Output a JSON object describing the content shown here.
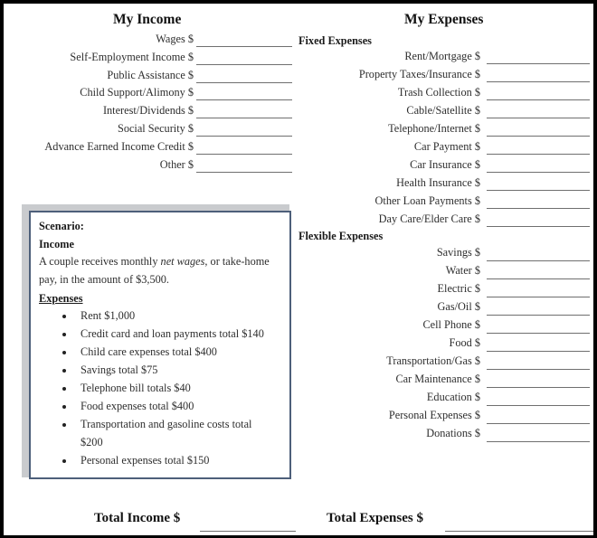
{
  "income": {
    "title": "My Income",
    "items": [
      {
        "label": "Wages $"
      },
      {
        "label": "Self-Employment Income $"
      },
      {
        "label": "Public Assistance $"
      },
      {
        "label": "Child Support/Alimony $"
      },
      {
        "label": "Interest/Dividends $"
      },
      {
        "label": "Social Security  $"
      },
      {
        "label": "Advance Earned Income Credit $"
      },
      {
        "label": "Other $"
      }
    ]
  },
  "expenses": {
    "title": "My Expenses",
    "fixed": {
      "heading": "Fixed Expenses",
      "items": [
        {
          "label": "Rent/Mortgage  $"
        },
        {
          "label": "Property Taxes/Insurance $"
        },
        {
          "label": "Trash Collection $"
        },
        {
          "label": "Cable/Satellite  $"
        },
        {
          "label": "Telephone/Internet $"
        },
        {
          "label": "Car Payment $"
        },
        {
          "label": "Car Insurance $"
        },
        {
          "label": "Health Insurance $"
        },
        {
          "label": "Other Loan Payments $"
        },
        {
          "label": "Day Care/Elder Care $"
        }
      ]
    },
    "flexible": {
      "heading": "Flexible Expenses",
      "items": [
        {
          "label": "Savings $"
        },
        {
          "label": "Water  $"
        },
        {
          "label": "Electric $"
        },
        {
          "label": "Gas/Oil $"
        },
        {
          "label": "Cell Phone $"
        },
        {
          "label": "Food $"
        },
        {
          "label": "Transportation/Gas $"
        },
        {
          "label": "Car Maintenance $"
        },
        {
          "label": "Education $"
        },
        {
          "label": "Personal Expenses $"
        },
        {
          "label": "Donations $"
        }
      ]
    }
  },
  "scenario": {
    "title": "Scenario:",
    "income_heading": "Income",
    "income_text_1a": "A couple receives monthly ",
    "income_text_1b": "net wages",
    "income_text_1c": ", or take-home",
    "income_text_2": "pay, in the amount of $3,500.",
    "expenses_heading": "Expenses",
    "bullets": [
      "Rent $1,000",
      "Credit card and loan payments total $140",
      "Child care expenses total $400",
      "Savings total $75",
      "Telephone bill totals $40",
      "Food expenses total $400",
      "Transportation and gasoline costs total",
      "$200",
      "Personal expenses total $150"
    ]
  },
  "totals": {
    "income_label": "Total Income  $",
    "expenses_label": "Total Expenses $"
  }
}
